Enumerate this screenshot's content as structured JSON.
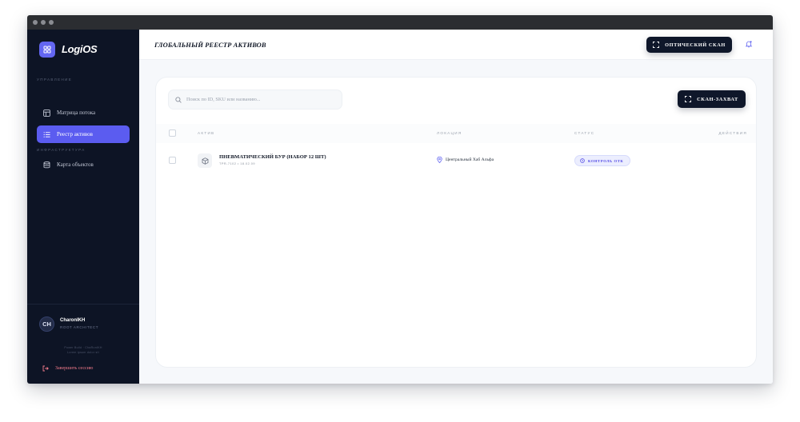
{
  "colors": {
    "sidebar_bg": "#0d1425",
    "accent": "#5b5cf0",
    "dark_button": "#0f172a",
    "badge_bg": "#eceefe",
    "badge_text": "#4f46e5",
    "logout": "#f17a8a"
  },
  "app": {
    "logo_text": "LogiOS",
    "logo_icon": "grid-icon"
  },
  "sidebar": {
    "section_management": "Управление",
    "section_infrastructure": "Инфраструктура",
    "items": [
      {
        "label": "Матрица потока",
        "icon": "board-icon",
        "active": false
      },
      {
        "label": "Реестр активов",
        "icon": "list-icon",
        "active": true
      },
      {
        "label": "Карта объектов",
        "icon": "database-icon",
        "active": false
      }
    ],
    "user": {
      "initials": "CH",
      "name": "CharonIKH",
      "role": "Root Architect"
    },
    "meta_line1": "Power Build · ChaRonIKH",
    "meta_line2": "Lorem ipsum dolor sit",
    "logout_label": "Завершить сессию"
  },
  "header": {
    "title": "ГЛОБАЛЬНЫЙ РЕЕСТР АКТИВОВ",
    "optical_scan_label": "ОПТИЧЕСКИЙ СКАН"
  },
  "registry": {
    "search_placeholder": "Поиск по ID, SKU или названию...",
    "scan_capture_label": "СКАН-ЗАХВАТ",
    "columns": {
      "asset": "Актив",
      "location": "Локация",
      "status": "Статус",
      "actions": "Действия"
    },
    "rows": [
      {
        "name": "ПНЕВМАТИЧЕСКИЙ БУР (НАБОР 12 ШТ)",
        "meta": "TPR-7102 • 18.02.09",
        "location": "Центральный Хаб Альфа",
        "status": "КОНТРОЛЬ ОТК",
        "icon": "box-icon"
      }
    ]
  }
}
